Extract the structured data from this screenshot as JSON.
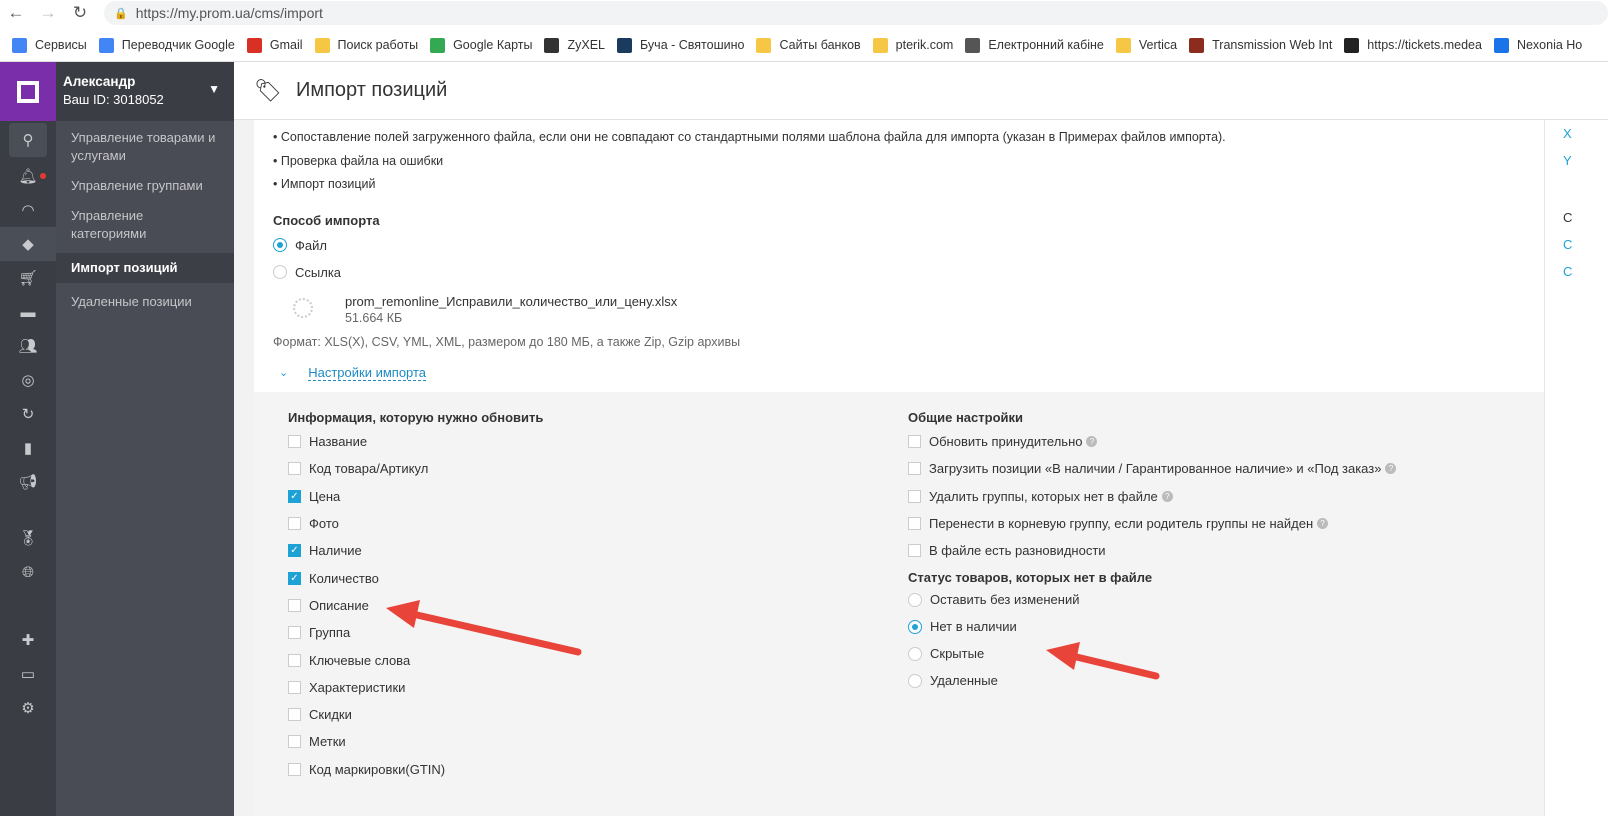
{
  "browser": {
    "url": "https://my.prom.ua/cms/import",
    "bookmarks": [
      {
        "label": "Сервисы",
        "icon": "apps-icon",
        "color": "#4285f4"
      },
      {
        "label": "Переводчик Google",
        "icon": "translate-icon",
        "color": "#4285f4"
      },
      {
        "label": "Gmail",
        "icon": "gmail-icon",
        "color": "#d93025"
      },
      {
        "label": "Поиск работы",
        "icon": "folder-icon",
        "color": "#f6c744"
      },
      {
        "label": "Google Карты",
        "icon": "maps-icon",
        "color": "#34a853"
      },
      {
        "label": "ZyXEL",
        "icon": "zyxel-icon",
        "color": "#333333"
      },
      {
        "label": "Буча - Святошино",
        "icon": "p-icon",
        "color": "#1a3b5d"
      },
      {
        "label": "Сайты банков",
        "icon": "folder-icon",
        "color": "#f6c744"
      },
      {
        "label": "pterik.com",
        "icon": "folder-icon",
        "color": "#f6c744"
      },
      {
        "label": "Електронний кабіне",
        "icon": "doc-icon",
        "color": "#555555"
      },
      {
        "label": "Vertica",
        "icon": "folder-icon",
        "color": "#f6c744"
      },
      {
        "label": "Transmission Web Int",
        "icon": "transmission-icon",
        "color": "#8b2c1e"
      },
      {
        "label": "https://tickets.medea",
        "icon": "figure-icon",
        "color": "#222222"
      },
      {
        "label": "Nexonia Ho",
        "icon": "x-icon",
        "color": "#1a73e8"
      }
    ]
  },
  "user": {
    "name": "Александр",
    "id": "Ваш ID: 3018052"
  },
  "subnav": [
    {
      "label": "Управление товарами и услугами",
      "active": false
    },
    {
      "label": "Управление группами",
      "active": false
    },
    {
      "label": "Управление категориями",
      "active": false
    },
    {
      "label": "Импорт позиций",
      "active": true
    },
    {
      "label": "Удаленные позиции",
      "active": false
    }
  ],
  "page_title": "Импорт позиций",
  "bullets": [
    "Сопоставление полей загруженного файла, если они не совпадают со стандартными полями шаблона файла для импорта (указан в Примерах файлов импорта).",
    "Проверка файла на ошибки",
    "Импорт позиций"
  ],
  "import_method": {
    "label": "Способ импорта",
    "options": [
      {
        "label": "Файл",
        "selected": true
      },
      {
        "label": "Ссылка",
        "selected": false
      }
    ]
  },
  "file": {
    "name": "prom_remonline_Исправили_количество_или_цену.xlsx",
    "size": "51.664 КБ"
  },
  "format_note": "Формат: XLS(X), CSV, YML, XML, размером до 180 МБ, а также Zip, Gzip архивы",
  "settings_toggle": "Настройки импорта",
  "update_info": {
    "label": "Информация, которую нужно обновить",
    "items": [
      {
        "label": "Название",
        "checked": false
      },
      {
        "label": "Код товара/Артикул",
        "checked": false
      },
      {
        "label": "Цена",
        "checked": true
      },
      {
        "label": "Фото",
        "checked": false
      },
      {
        "label": "Наличие",
        "checked": true
      },
      {
        "label": "Количество",
        "checked": true
      },
      {
        "label": "Описание",
        "checked": false
      },
      {
        "label": "Группа",
        "checked": false
      },
      {
        "label": "Ключевые слова",
        "checked": false
      },
      {
        "label": "Характеристики",
        "checked": false
      },
      {
        "label": "Скидки",
        "checked": false
      },
      {
        "label": "Метки",
        "checked": false
      },
      {
        "label": "Код маркировки(GTIN)",
        "checked": false
      }
    ]
  },
  "general": {
    "label": "Общие настройки",
    "items": [
      {
        "label": "Обновить принудительно",
        "checked": false,
        "help": true
      },
      {
        "label": "Загрузить позиции «В наличии / Гарантированное наличие» и «Под заказ»",
        "checked": false,
        "help": true
      },
      {
        "label": "Удалить группы, которых нет в файле",
        "checked": false,
        "help": true
      },
      {
        "label": "Перенести в корневую группу, если родитель группы не найден",
        "checked": false,
        "help": true
      },
      {
        "label": "В файле есть разновидности",
        "checked": false,
        "help": false
      }
    ]
  },
  "status": {
    "label": "Статус товаров, которых нет в файле",
    "options": [
      {
        "label": "Оставить без изменений",
        "selected": false
      },
      {
        "label": "Нет в наличии",
        "selected": true
      },
      {
        "label": "Скрытые",
        "selected": false
      },
      {
        "label": "Удаленные",
        "selected": false
      }
    ]
  },
  "right_strip": [
    "Х",
    "Y",
    "С",
    "С",
    "С"
  ],
  "colors": {
    "accent": "#1ea2d5",
    "brand": "#7b2eaa",
    "arrow": "#e8443a"
  }
}
